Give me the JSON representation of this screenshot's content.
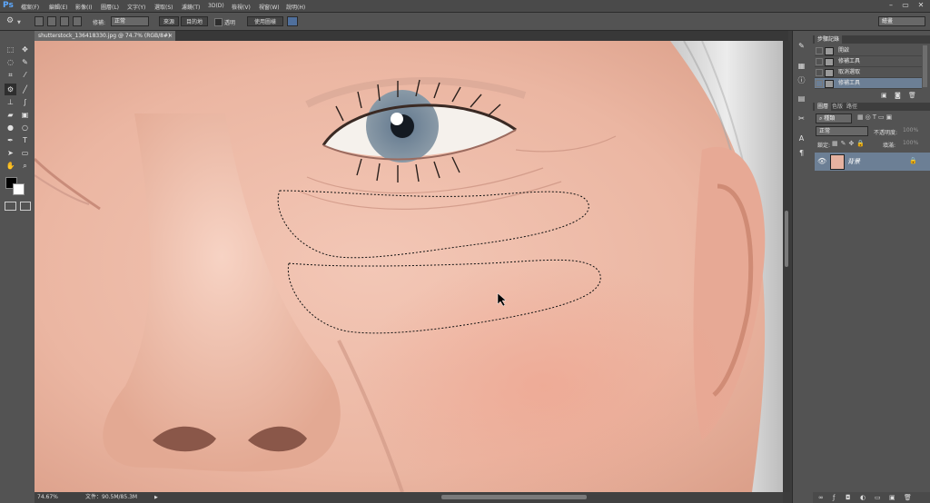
{
  "app": {
    "logo": "Ps"
  },
  "menu": [
    "檔案(F)",
    "編輯(E)",
    "影像(I)",
    "圖層(L)",
    "文字(Y)",
    "選取(S)",
    "濾鏡(T)",
    "3D(D)",
    "檢視(V)",
    "視窗(W)",
    "說明(H)"
  ],
  "window_controls": {
    "minimize": "–",
    "maximize": "▭",
    "close": "✕"
  },
  "options": {
    "mode_label": "修補:",
    "mode_value": "正常",
    "source_button": "來源",
    "dest_button": "目的地",
    "transparent_label": "透明",
    "use_pattern_button": "使用圖樣",
    "workspace": "繪畫"
  },
  "document": {
    "tab_title": "shutterstock_136418330.jpg @ 74.7% (RGB/8#)",
    "zoom": "74.67%",
    "file_info": "文件：90.5M/85.3M"
  },
  "history": {
    "tabs": [
      "步驟記錄"
    ],
    "items": [
      {
        "label": "開啟",
        "selected": false
      },
      {
        "label": "修補工具",
        "selected": false
      },
      {
        "label": "取消選取",
        "selected": false
      },
      {
        "label": "修補工具",
        "selected": true
      }
    ]
  },
  "layers": {
    "tabs": [
      "圖層",
      "色版",
      "路徑"
    ],
    "filter_kind": "種類",
    "blend_mode": "正常",
    "opacity_label": "不透明度:",
    "opacity_value": "100%",
    "lock_label": "鎖定:",
    "fill_label": "填滿:",
    "fill_value": "100%",
    "items": [
      {
        "name": "背景",
        "visible": true,
        "locked": true
      }
    ]
  },
  "colors": {
    "accent": "#6c7f95",
    "ui_bg": "#535353",
    "selection": "#111111"
  }
}
